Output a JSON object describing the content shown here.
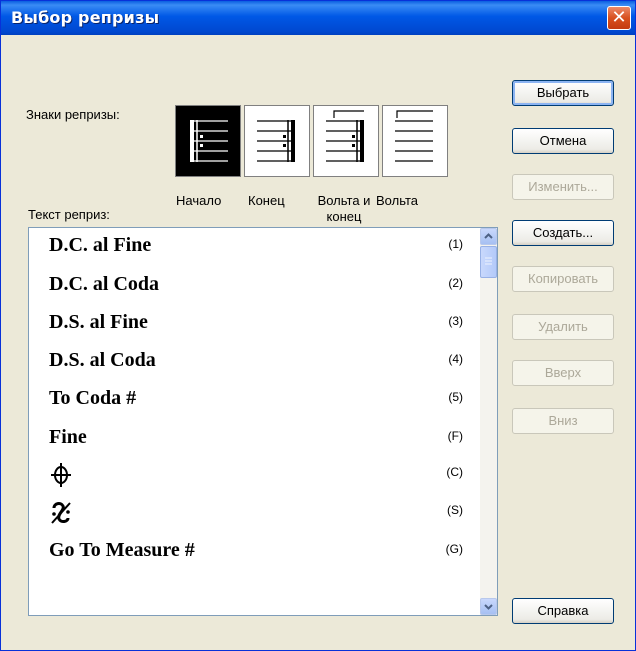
{
  "window": {
    "title": "Выбор репризы",
    "close_glyph": "✕"
  },
  "marks": {
    "label": "Знаки репризы:",
    "items": [
      {
        "label": "Начало",
        "icon": "repeat-start-icon",
        "selected": true
      },
      {
        "label": "Конец",
        "icon": "repeat-end-icon",
        "selected": false
      },
      {
        "label": "Вольта и конец",
        "icon": "volta-end-icon",
        "selected": false
      },
      {
        "label": "Вольта",
        "icon": "volta-icon",
        "selected": false
      }
    ]
  },
  "list": {
    "label": "Текст реприз:",
    "rows": [
      {
        "text": "D.C. al Fine",
        "code": "(1)"
      },
      {
        "text": "D.C. al Coda",
        "code": "(2)"
      },
      {
        "text": "D.S. al Fine",
        "code": "(3)"
      },
      {
        "text": "D.S. al Coda",
        "code": "(4)"
      },
      {
        "text": "To Coda #",
        "code": "(5)"
      },
      {
        "text": "Fine",
        "code": "(F)"
      },
      {
        "text": "",
        "code": "(C)",
        "icon": "coda-icon"
      },
      {
        "text": "",
        "code": "(S)",
        "icon": "segno-icon"
      },
      {
        "text": "Go To Measure #",
        "code": "(G)"
      }
    ]
  },
  "buttons": {
    "select": "Выбрать",
    "cancel": "Отмена",
    "edit": "Изменить...",
    "create": "Создать...",
    "copy": "Копировать",
    "delete": "Удалить",
    "up": "Вверх",
    "down": "Вниз",
    "help": "Справка"
  },
  "colors": {
    "titlebar": "#0058e6",
    "client": "#ece9d8",
    "disabled_text": "#aca899"
  }
}
